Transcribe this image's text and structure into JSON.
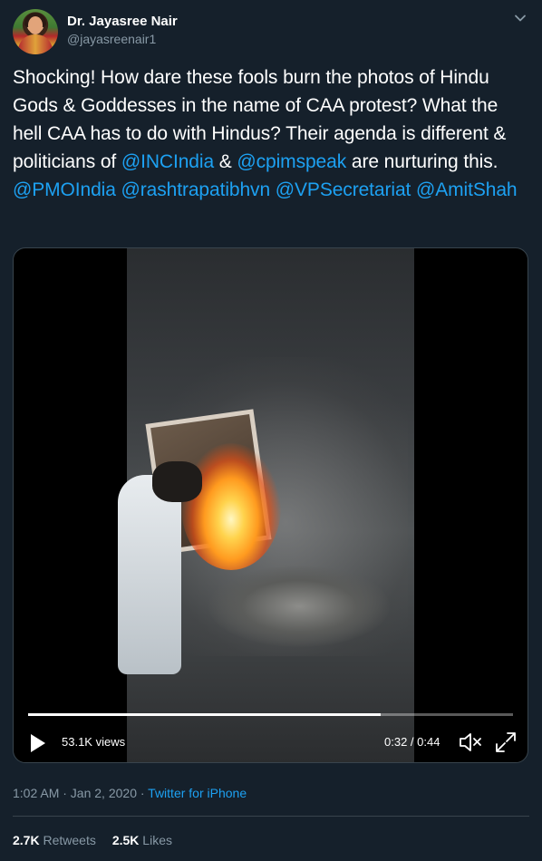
{
  "author": {
    "name": "Dr. Jayasree Nair",
    "handle": "@jayasreenair1"
  },
  "tweet": {
    "segments": [
      {
        "text": "Shocking! How dare these fools burn the photos of Hindu Gods & Goddesses in the name of CAA protest? What the hell CAA has to do with Hindus? Their agenda is different & politicians of ",
        "mention": false
      },
      {
        "text": "@INCIndia",
        "mention": true
      },
      {
        "text": " & ",
        "mention": false
      },
      {
        "text": "@cpimspeak",
        "mention": true
      },
      {
        "text": " are nurturing this. ",
        "mention": false
      },
      {
        "text": "@PMOIndia",
        "mention": true
      },
      {
        "text": " ",
        "mention": false
      },
      {
        "text": "@rashtrapatibhvn",
        "mention": true
      },
      {
        "text": " ",
        "mention": false
      },
      {
        "text": "@VPSecretariat",
        "mention": true
      },
      {
        "text": " ",
        "mention": false
      },
      {
        "text": "@AmitShah",
        "mention": true
      }
    ]
  },
  "video": {
    "views": "53.1K views",
    "time": "0:32 / 0:44",
    "progress": 0.727
  },
  "meta": {
    "timestamp": "1:02 AM · Jan 2, 2020 · ",
    "source": "Twitter for iPhone"
  },
  "stats": {
    "retweets_count": "2.7K",
    "retweets_label": "Retweets",
    "likes_count": "2.5K",
    "likes_label": "Likes"
  },
  "icons": {
    "chevron": "chevron-down-icon",
    "play": "play-icon",
    "mute": "mute-icon",
    "fullscreen": "fullscreen-icon"
  },
  "colors": {
    "background": "#15202b",
    "accent": "#1da1f2",
    "secondary_text": "#8899a6",
    "border": "#38444d"
  }
}
